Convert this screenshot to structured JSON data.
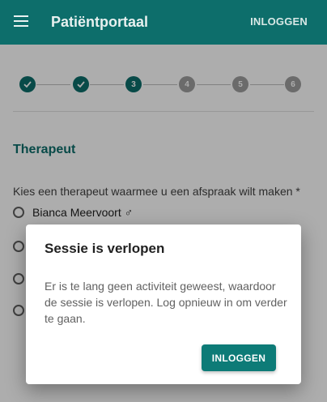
{
  "app": {
    "title": "Patiëntportaal",
    "login_label": "INLOGGEN"
  },
  "stepper": {
    "steps": [
      {
        "label": "1",
        "state": "done"
      },
      {
        "label": "2",
        "state": "done"
      },
      {
        "label": "3",
        "state": "active"
      },
      {
        "label": "4",
        "state": "todo"
      },
      {
        "label": "5",
        "state": "todo"
      },
      {
        "label": "6",
        "state": "todo"
      }
    ]
  },
  "form": {
    "section_title": "Therapeut",
    "question": "Kies een therapeut waarmee u een afspraak wilt maken *",
    "options": [
      {
        "label": "Bianca Meervoort ♂"
      }
    ]
  },
  "dialog": {
    "title": "Sessie is verlopen",
    "message": "Er is te lang geen activiteit geweest, waardoor de sessie is verlopen. Log opnieuw in om verder te gaan.",
    "button_label": "INLOGGEN"
  },
  "colors": {
    "primary": "#0d6e6b",
    "inactive_step": "#9e9e9e"
  }
}
